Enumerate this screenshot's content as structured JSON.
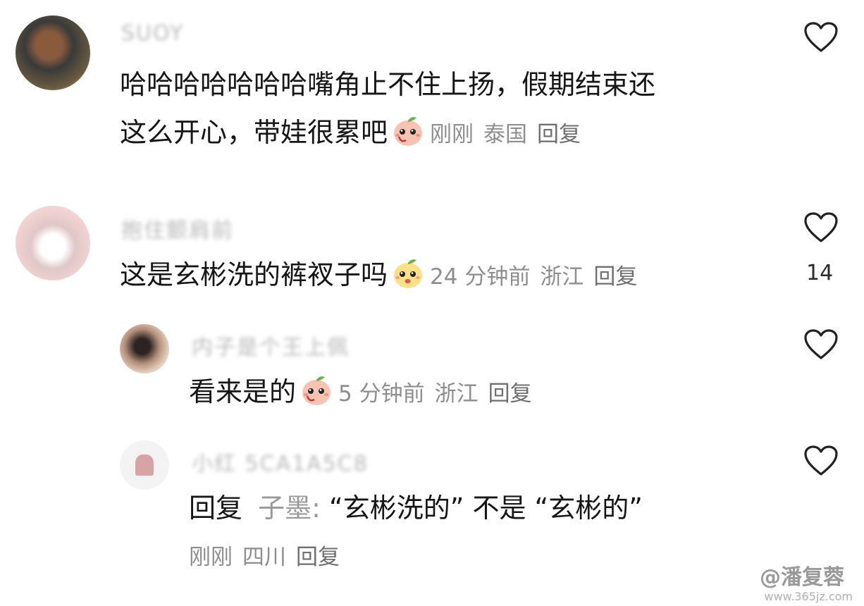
{
  "comments": [
    {
      "username": "SUOY",
      "text_line1": "哈哈哈哈哈哈哈嘴角止不住上扬，假期结束还",
      "text_line2": "这么开心，带娃很累吧",
      "emoji": "peach-face-emoji",
      "time": "刚刚",
      "location": "泰国",
      "reply_label": "回复",
      "likes": ""
    },
    {
      "username": "抱住颤肩前",
      "text": "这是玄彬洗的裤衩子吗",
      "emoji": "peach-face-emoji",
      "time": "24 分钟前",
      "location": "浙江",
      "reply_label": "回复",
      "likes": "14"
    },
    {
      "username": "内子是个王上佩",
      "text": "看来是的",
      "emoji": "peach-face-emoji",
      "time": "5 分钟前",
      "location": "浙江",
      "reply_label": "回复",
      "likes": ""
    },
    {
      "username": "小红 5CA1A5C8",
      "reply_prefix": "回复",
      "reply_to": "子墨:",
      "text": "“玄彬洗的” 不是 “玄彬的”",
      "time": "刚刚",
      "location": "四川",
      "reply_label": "回复",
      "likes": ""
    }
  ],
  "watermark": {
    "text": "@潘复蓉",
    "url": "www.365jz.com"
  },
  "colors": {
    "text": "#161616",
    "meta": "#8e8e8e",
    "username": "#b8b8b8"
  }
}
